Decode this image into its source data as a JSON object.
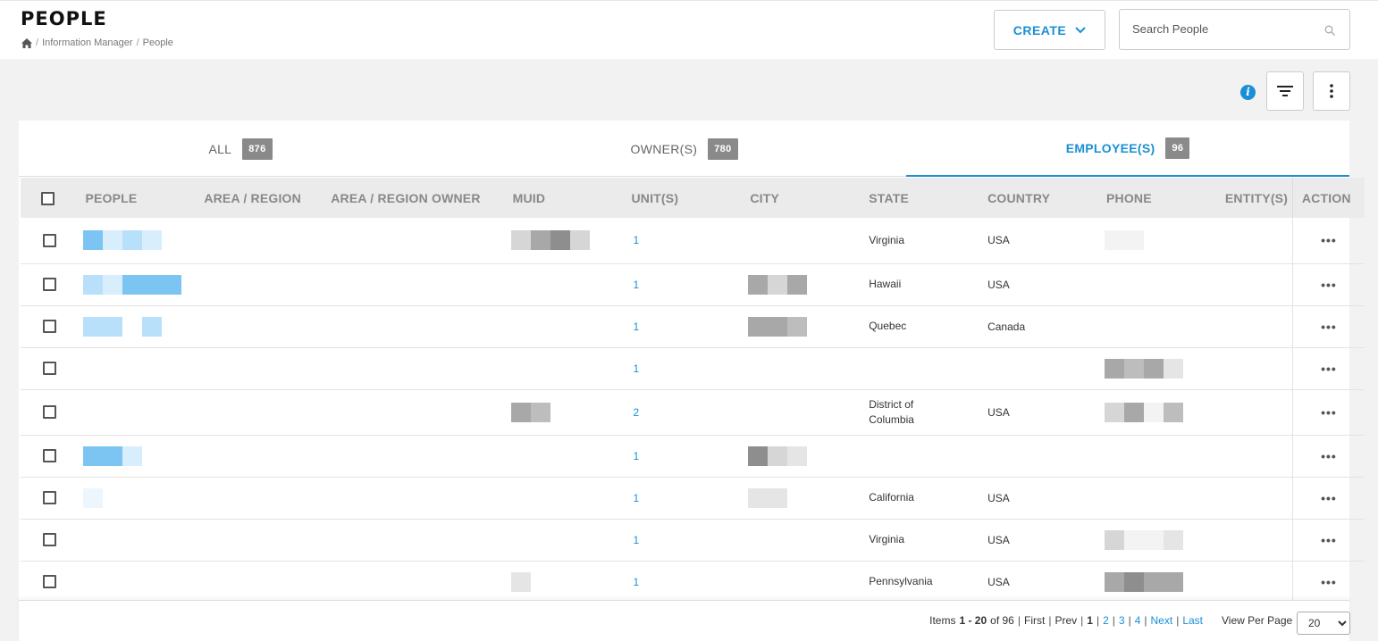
{
  "header": {
    "title": "PEOPLE",
    "breadcrumb": [
      "Information Manager",
      "People"
    ],
    "create_label": "CREATE",
    "search_placeholder": "Search People"
  },
  "tabs": [
    {
      "label": "ALL",
      "count": "876"
    },
    {
      "label": "OWNER(S)",
      "count": "780"
    },
    {
      "label": "EMPLOYEE(S)",
      "count": "96",
      "active": true
    }
  ],
  "columns": [
    "PEOPLE",
    "AREA / REGION",
    "AREA / REGION OWNER",
    "MUID",
    "UNIT(S)",
    "CITY",
    "STATE",
    "COUNTRY",
    "PHONE",
    "ENTITY(S)",
    "ACTION"
  ],
  "rows": [
    {
      "units": "1",
      "state": "Virginia",
      "country": "USA"
    },
    {
      "units": "1",
      "state": "Hawaii",
      "country": "USA"
    },
    {
      "units": "1",
      "state": "Quebec",
      "country": "Canada"
    },
    {
      "units": "1",
      "state": "",
      "country": ""
    },
    {
      "units": "2",
      "state": "District of Columbia",
      "country": "USA"
    },
    {
      "units": "1",
      "state": "",
      "country": ""
    },
    {
      "units": "1",
      "state": "California",
      "country": "USA"
    },
    {
      "units": "1",
      "state": "Virginia",
      "country": "USA"
    },
    {
      "units": "1",
      "state": "Pennsylvania",
      "country": "USA"
    }
  ],
  "action_glyph": "•••",
  "pagination": {
    "items_label": "Items",
    "range": "1 - 20",
    "of_label": "of 96",
    "first": "First",
    "prev": "Prev",
    "current": "1",
    "pages": [
      "2",
      "3",
      "4"
    ],
    "next": "Next",
    "last": "Last",
    "view_per_page_label": "View Per Page",
    "per_page_value": "20"
  },
  "colors": {
    "accent": "#1a8fd6",
    "badge": "#8a8a8a"
  }
}
